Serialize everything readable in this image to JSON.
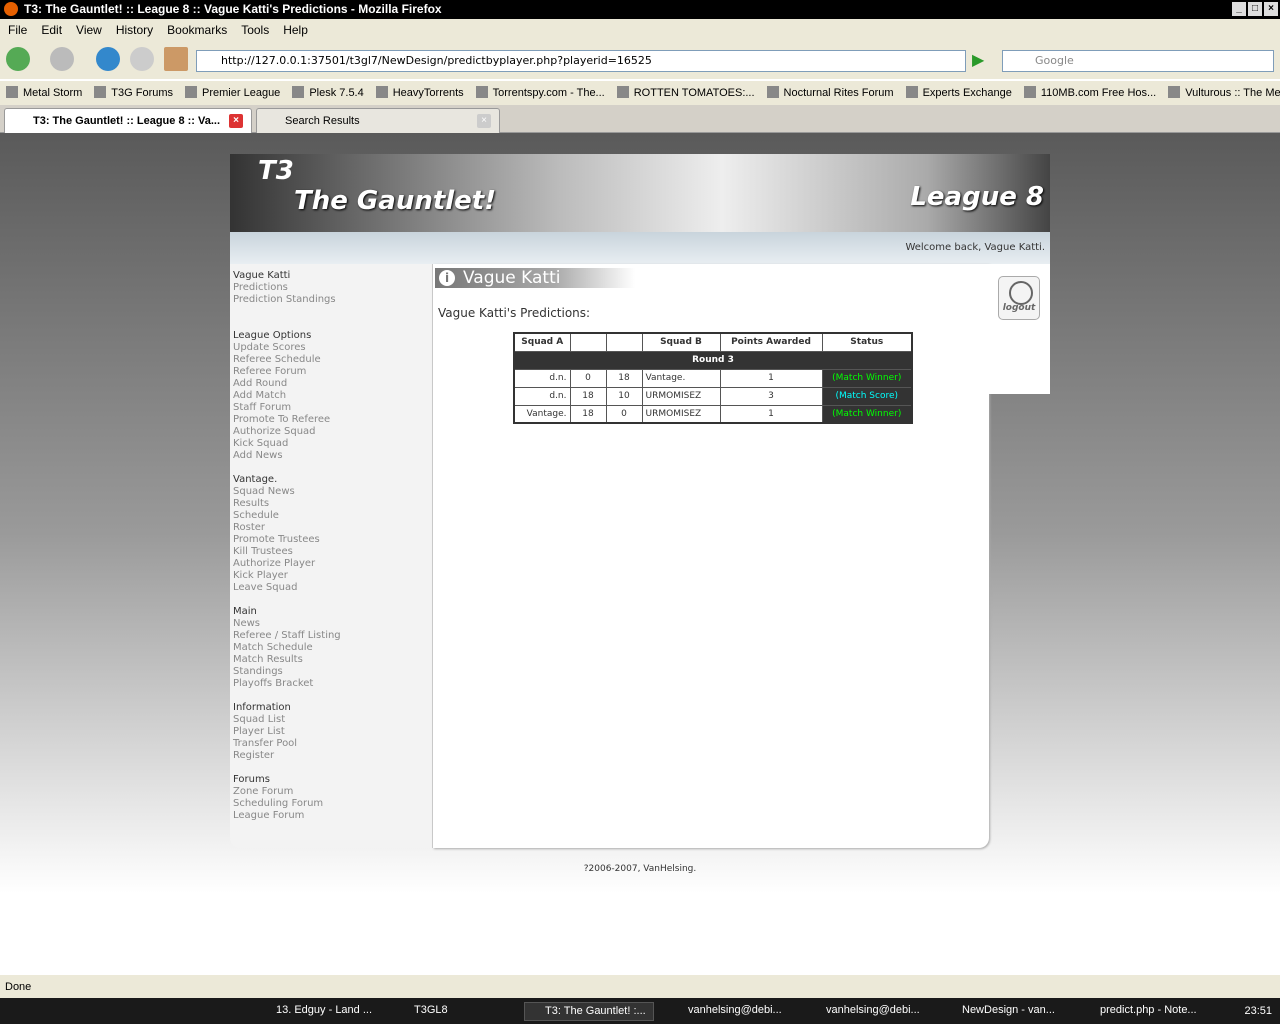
{
  "window": {
    "title": "T3: The Gauntlet! :: League 8 :: Vague Katti's Predictions - Mozilla Firefox"
  },
  "menu": [
    "File",
    "Edit",
    "View",
    "History",
    "Bookmarks",
    "Tools",
    "Help"
  ],
  "url": "http://127.0.0.1:37501/t3gl7/NewDesign/predictbyplayer.php?playerid=16525",
  "search_placeholder": "Google",
  "bookmarks": [
    "Metal Storm",
    "T3G Forums",
    "Premier League",
    "Plesk 7.5.4",
    "HeavyTorrents",
    "Torrentspy.com - The...",
    "ROTTEN TOMATOES:...",
    "Nocturnal Rites Forum",
    "Experts Exchange",
    "110MB.com Free Hos...",
    "Vulturous :: The Meta..."
  ],
  "tabs": [
    {
      "label": "T3: The Gauntlet! :: League 8 :: Va..."
    },
    {
      "label": "Search Results"
    }
  ],
  "banner": {
    "t3": "T3",
    "title": "The Gauntlet!",
    "league": "League 8"
  },
  "welcome": "Welcome back, Vague Katti.",
  "sidebar": [
    {
      "items": [
        "Vague Katti",
        "Predictions",
        "Prediction Standings"
      ]
    },
    {
      "items": [
        "League Options",
        "Update Scores",
        "Referee Schedule",
        "Referee Forum",
        "Add Round",
        "Add Match",
        "Staff Forum",
        "Promote To Referee",
        "Authorize Squad",
        "Kick Squad",
        "Add News"
      ]
    },
    {
      "items": [
        "Vantage.",
        "Squad News",
        "Results",
        "Schedule",
        "Roster",
        "Promote Trustees",
        "Kill Trustees",
        "Authorize Player",
        "Kick Player",
        "Leave Squad"
      ]
    },
    {
      "items": [
        "Main",
        "News",
        "Referee / Staff Listing",
        "Match Schedule",
        "Match Results",
        "Standings",
        "Playoffs Bracket"
      ]
    },
    {
      "items": [
        "Information",
        "Squad List",
        "Player List",
        "Transfer Pool",
        "Register"
      ]
    },
    {
      "items": [
        "Forums",
        "Zone Forum",
        "Scheduling Forum",
        "League Forum"
      ]
    }
  ],
  "page": {
    "heading": "Vague Katti",
    "subtitle": "Vague Katti's Predictions:",
    "table": {
      "headers": [
        "Squad A",
        "",
        "",
        "Squad B",
        "Points Awarded",
        "Status"
      ],
      "round": "Round 3",
      "rows": [
        {
          "a": "d.n.",
          "sa": "0",
          "sb": "18",
          "b": "Vantage.",
          "pts": "1",
          "status": "(Match Winner)",
          "color": "#00ff00"
        },
        {
          "a": "d.n.",
          "sa": "18",
          "sb": "10",
          "b": "URMOMISEZ",
          "pts": "3",
          "status": "(Match Score)",
          "color": "#00ffff"
        },
        {
          "a": "Vantage.",
          "sa": "18",
          "sb": "0",
          "b": "URMOMISEZ",
          "pts": "1",
          "status": "(Match Winner)",
          "color": "#00ff00"
        }
      ]
    }
  },
  "logout": "logout",
  "footer": "?2006-2007, VanHelsing.",
  "status": "Done",
  "taskbar": {
    "items": [
      "13. Edguy - Land ...",
      "T3GL8",
      "T3: The Gauntlet! :...",
      "vanhelsing@debi...",
      "vanhelsing@debi...",
      "NewDesign - van...",
      "predict.php - Note..."
    ],
    "clock": "23:51"
  }
}
